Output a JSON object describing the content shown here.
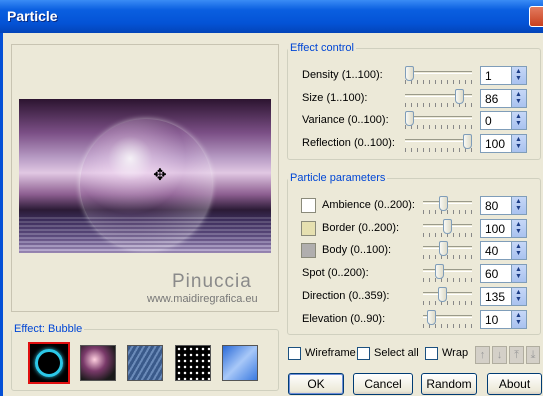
{
  "window": {
    "title": "Particle"
  },
  "preview": {
    "watermark": "Pinuccia",
    "watermark_url": "www.maidiregrafica.eu"
  },
  "effect_control": {
    "legend": "Effect control",
    "rows": [
      {
        "label": "Density (1..100):",
        "value": "1",
        "level": 0.0
      },
      {
        "label": "Size (1..100):",
        "value": "86",
        "level": 0.86
      },
      {
        "label": "Variance (0..100):",
        "value": "0",
        "level": 0.0
      },
      {
        "label": "Reflection (0..100):",
        "value": "100",
        "level": 1.0
      }
    ]
  },
  "particle_params": {
    "legend": "Particle parameters",
    "rows": [
      {
        "label": "Ambience (0..200):",
        "value": "80",
        "level": 0.4
      },
      {
        "label": "Border (0..200):",
        "value": "100",
        "level": 0.5
      },
      {
        "label": "Body (0..100):",
        "value": "40",
        "level": 0.4
      },
      {
        "label": "Spot (0..200):",
        "value": "60",
        "level": 0.3
      },
      {
        "label": "Direction (0..359):",
        "value": "135",
        "level": 0.376
      },
      {
        "label": "Elevation (0..90):",
        "value": "10",
        "level": 0.11
      }
    ],
    "swatch_colors": [
      "#ffffff",
      "#e6e0b0",
      "#b0aeae"
    ]
  },
  "effect": {
    "legend": "Effect: Bubble"
  },
  "options": {
    "wireframe": "Wireframe",
    "select_all": "Select all",
    "wrap": "Wrap"
  },
  "buttons": {
    "ok": "OK",
    "cancel": "Cancel",
    "random": "Random",
    "about": "About"
  }
}
